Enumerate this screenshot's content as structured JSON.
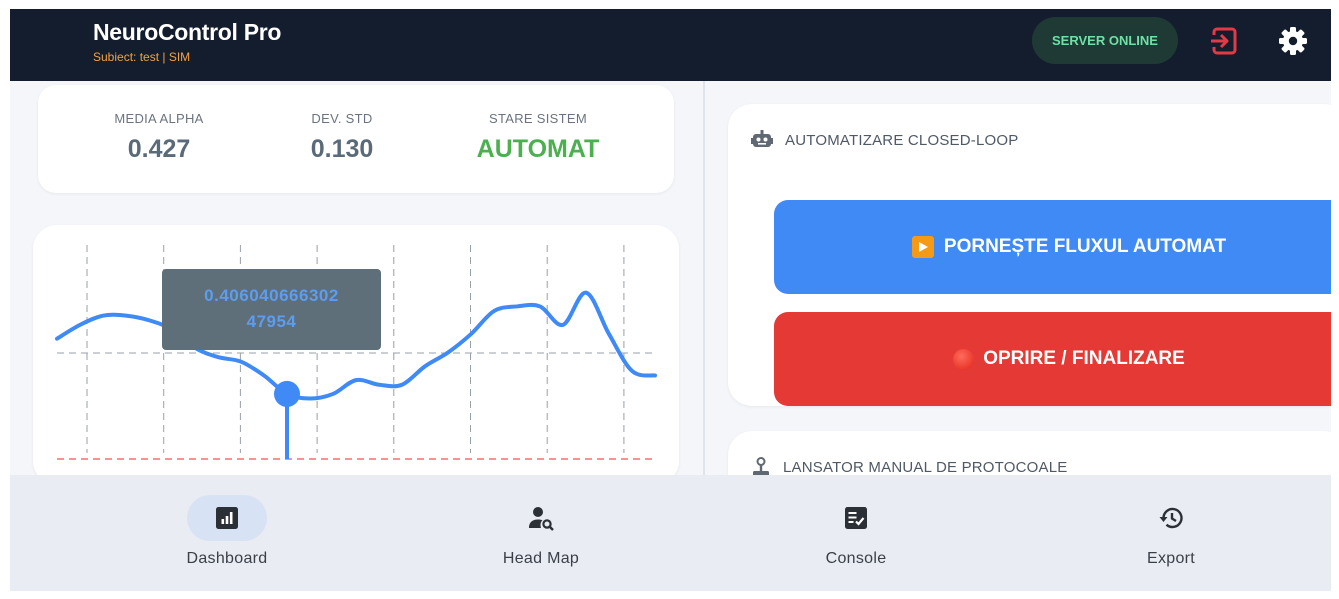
{
  "header": {
    "title": "NeuroControl Pro",
    "subtitle": "Subiect: test | SIM",
    "server_status": "SERVER ONLINE",
    "colors": {
      "bar": "#141d2e",
      "subtitle": "#f0a341",
      "status_text": "#6fe0a6",
      "logout_icon": "#e53945"
    }
  },
  "stats": [
    {
      "label": "MEDIA ALPHA",
      "value": "0.427"
    },
    {
      "label": "DEV. STD",
      "value": "0.130"
    },
    {
      "label": "STARE SISTEM",
      "value": "AUTOMAT",
      "color": "#4caf50"
    }
  ],
  "chart_data": {
    "type": "line",
    "series": [
      {
        "values": [
          0.42,
          0.45,
          0.47,
          0.47,
          0.46,
          0.44,
          0.4,
          0.38,
          0.37,
          0.34,
          0.3,
          0.29,
          0.3,
          0.33,
          0.32,
          0.32,
          0.36,
          0.39,
          0.43,
          0.48,
          0.49,
          0.49,
          0.45,
          0.52,
          0.43,
          0.35,
          0.34
        ]
      }
    ],
    "reference_lines": [
      {
        "style": "dashed-gray"
      },
      {
        "style": "dashed-red"
      }
    ],
    "grid": "vertical dashed",
    "tooltip": {
      "line1": "0.406040666302",
      "line2": "47954"
    },
    "line_color": "#3f8af4"
  },
  "automation": {
    "section_title": "AUTOMATIZARE CLOSED-LOOP",
    "start_label": "PORNEȘTE FLUXUL AUTOMAT",
    "stop_label": "OPRIRE / FINALIZARE",
    "colors": {
      "start": "#3f8af4",
      "stop": "#e53935"
    }
  },
  "manual": {
    "section_title": "LANSATOR MANUAL DE PROTOCOALE"
  },
  "nav": {
    "items": [
      {
        "label": "Dashboard",
        "icon": "dashboard-icon",
        "active": true
      },
      {
        "label": "Head Map",
        "icon": "person-search-icon",
        "active": false
      },
      {
        "label": "Console",
        "icon": "checklist-icon",
        "active": false
      },
      {
        "label": "Export",
        "icon": "history-icon",
        "active": false
      }
    ]
  }
}
